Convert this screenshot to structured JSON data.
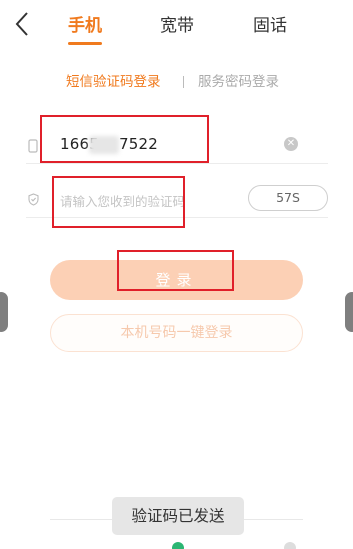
{
  "header": {
    "tabs": [
      {
        "label": "手机",
        "active": true
      },
      {
        "label": "宽带",
        "active": false
      },
      {
        "label": "固话",
        "active": false
      }
    ]
  },
  "login_modes": {
    "sms": "短信验证码登录",
    "password": "服务密码登录"
  },
  "phone_field": {
    "value": "1665",
    "value_tail": "7522"
  },
  "code_field": {
    "placeholder": "请输入您收到的验证码",
    "countdown": "57S"
  },
  "buttons": {
    "login": "登录",
    "one_click": "本机号码一键登录"
  },
  "toast": "验证码已发送",
  "colors": {
    "accent": "#f07a1e",
    "login_button": "#fcd0b5",
    "annotation": "#e0202a"
  }
}
